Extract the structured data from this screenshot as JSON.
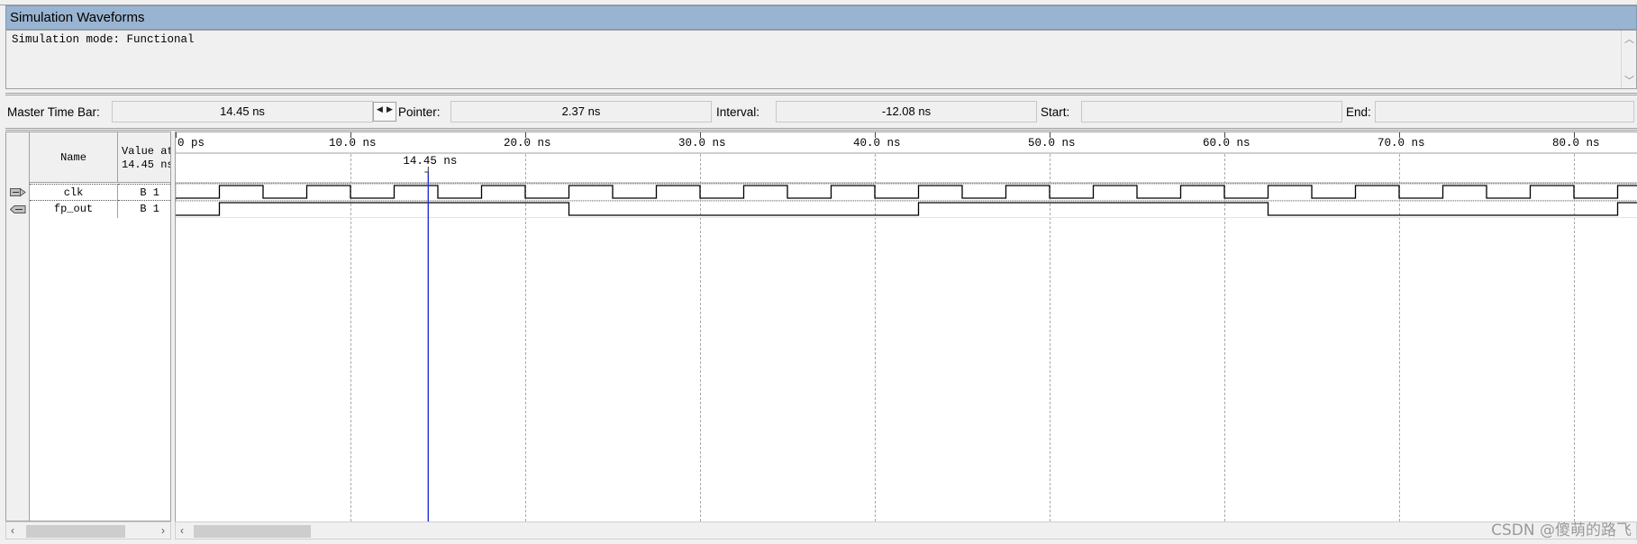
{
  "window": {
    "title": "Simulation Waveforms"
  },
  "mode": {
    "text": "Simulation mode: Functional"
  },
  "time_bar": {
    "master_label": "Master Time Bar:",
    "master_value": "14.45 ns",
    "pointer_label": "Pointer:",
    "pointer_value": "2.37 ns",
    "interval_label": "Interval:",
    "interval_value": "-12.08 ns",
    "start_label": "Start:",
    "start_value": "",
    "end_label": "End:",
    "end_value": ""
  },
  "columns": {
    "name": "Name",
    "value_line1": "Value at",
    "value_line2": "14.45 ns"
  },
  "signals": [
    {
      "name": "clk",
      "value": "B 1",
      "icon": "input-pin-icon"
    },
    {
      "name": "fp_out",
      "value": "B 1",
      "icon": "output-pin-icon"
    }
  ],
  "timeline": {
    "ticks": [
      "0 ps",
      "10.0 ns",
      "20.0 ns",
      "30.0 ns",
      "40.0 ns",
      "50.0 ns",
      "60.0 ns",
      "70.0 ns",
      "80.0 ns"
    ],
    "tick_step_ns": 10,
    "marker_label": "14.45 ns",
    "marker_time_ns": 14.45,
    "clk_period_ns": 5,
    "clk_first_rise_ns": 2.5,
    "fp_out_edges_ns": [
      2.5,
      22.5,
      42.5,
      62.5,
      82.5
    ]
  },
  "watermark": "CSDN @傻萌的路飞"
}
